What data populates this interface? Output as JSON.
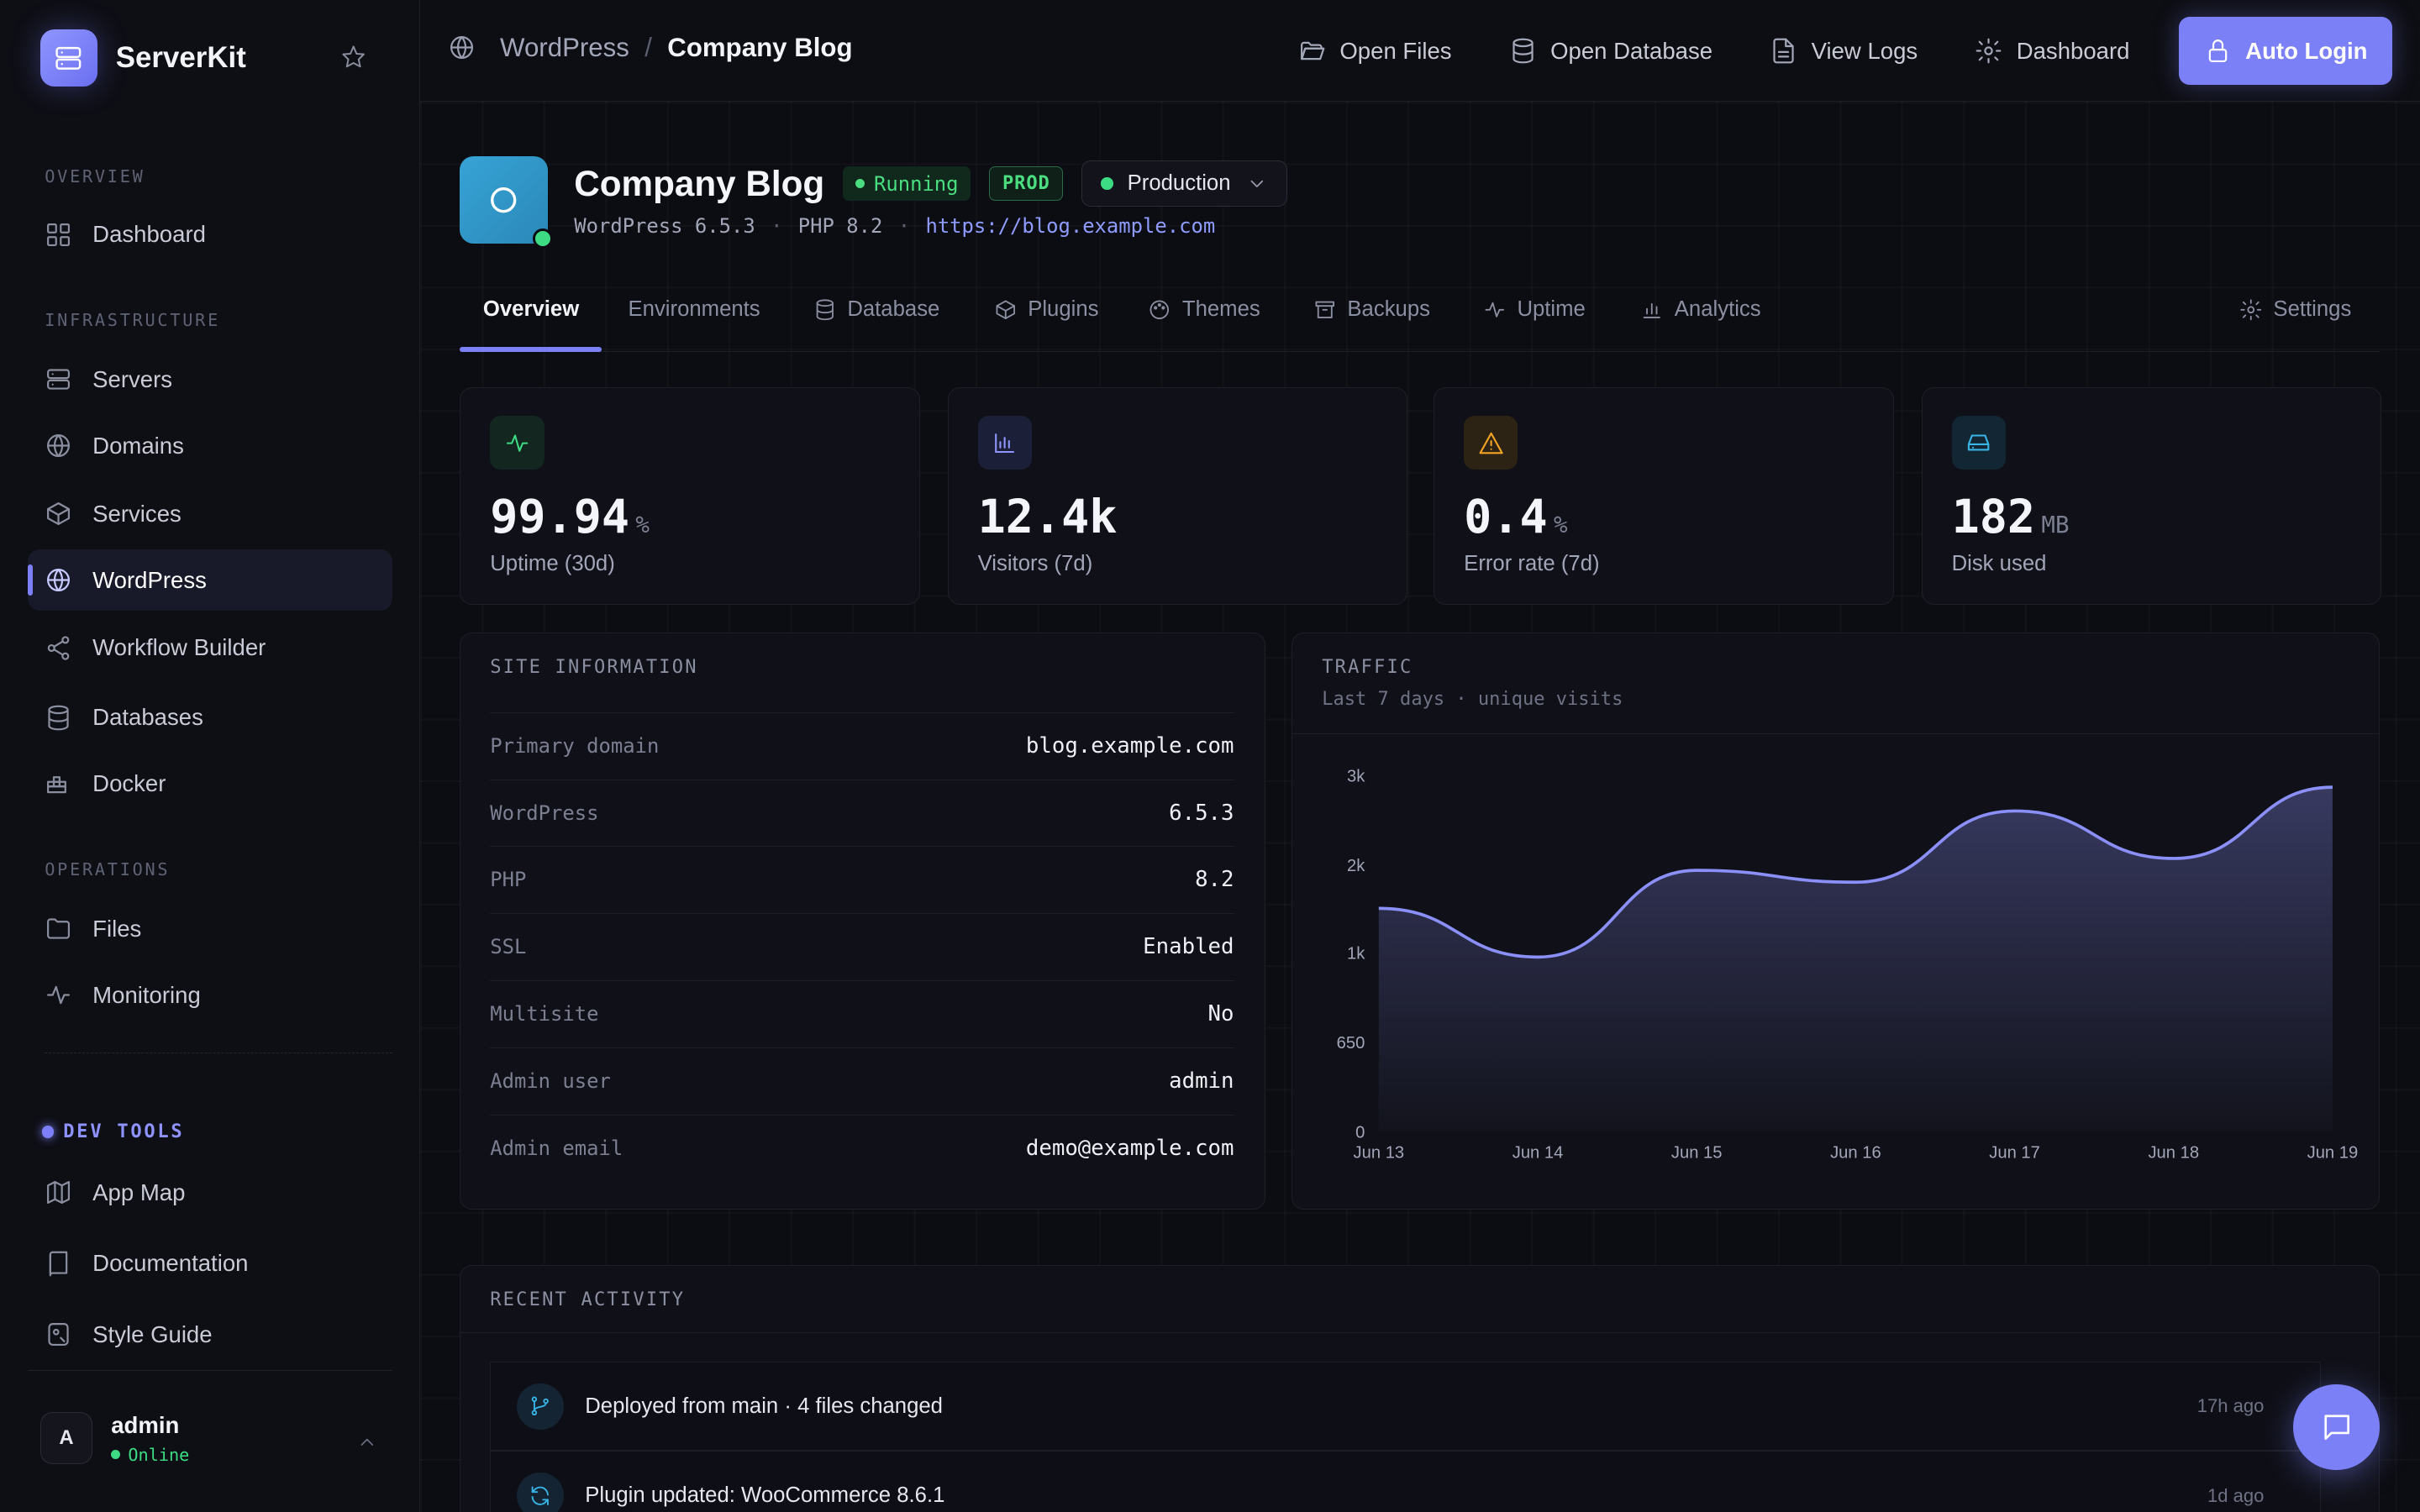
{
  "app": {
    "name": "ServerKit"
  },
  "sidebar": {
    "sections": {
      "overview": "OVERVIEW",
      "infrastructure": "INFRASTRUCTURE",
      "operations": "OPERATIONS",
      "devtools": "DEV TOOLS"
    },
    "items": {
      "dashboard": "Dashboard",
      "servers": "Servers",
      "domains": "Domains",
      "services": "Services",
      "wordpress": "WordPress",
      "workflow": "Workflow Builder",
      "databases": "Databases",
      "docker": "Docker",
      "files": "Files",
      "monitoring": "Monitoring",
      "appmap": "App Map",
      "documentation": "Documentation",
      "styleguide": "Style Guide"
    },
    "active": "wordpress",
    "user": {
      "initial": "A",
      "name": "admin",
      "status": "Online"
    }
  },
  "topbar": {
    "breadcrumb": {
      "parent": "WordPress",
      "separator": "/",
      "current": "Company Blog"
    },
    "actions": {
      "open_files": "Open Files",
      "open_database": "Open Database",
      "view_logs": "View Logs",
      "dashboard": "Dashboard",
      "auto_login": "Auto Login"
    }
  },
  "site": {
    "title": "Company Blog",
    "status": "Running",
    "badge": "PROD",
    "environment": "Production",
    "wordpress": "WordPress 6.5.3",
    "php": "PHP 8.2",
    "separator": "·",
    "url": "https://blog.example.com"
  },
  "tabs": {
    "overview": "Overview",
    "environments": "Environments",
    "database": "Database",
    "plugins": "Plugins",
    "themes": "Themes",
    "backups": "Backups",
    "uptime": "Uptime",
    "analytics": "Analytics",
    "settings": "Settings"
  },
  "stats": {
    "uptime": {
      "value": "99.94",
      "unit": "%",
      "label": "Uptime (30d)"
    },
    "visitors": {
      "value": "12.4k",
      "unit": "",
      "label": "Visitors (7d)"
    },
    "errors": {
      "value": "0.4",
      "unit": "%",
      "label": "Error rate (7d)"
    },
    "disk": {
      "value": "182",
      "unit": "MB",
      "label": "Disk used"
    }
  },
  "site_info": {
    "title": "SITE INFORMATION",
    "rows": [
      {
        "key": "Primary domain",
        "value": "blog.example.com"
      },
      {
        "key": "WordPress",
        "value": "6.5.3"
      },
      {
        "key": "PHP",
        "value": "8.2"
      },
      {
        "key": "SSL",
        "value": "Enabled"
      },
      {
        "key": "Multisite",
        "value": "No"
      },
      {
        "key": "Admin user",
        "value": "admin"
      },
      {
        "key": "Admin email",
        "value": "demo@example.com"
      }
    ]
  },
  "traffic": {
    "title": "TRAFFIC",
    "subtitle": "Last 7 days · unique visits"
  },
  "chart_data": {
    "type": "area",
    "title": "TRAFFIC",
    "subtitle": "Last 7 days · unique visits",
    "x": [
      "Jun 13",
      "Jun 14",
      "Jun 15",
      "Jun 16",
      "Jun 17",
      "Jun 18",
      "Jun 19"
    ],
    "y_ticks": [
      "0",
      "650",
      "1k",
      "2k",
      "3k"
    ],
    "values": [
      1880,
      1470,
      2200,
      2100,
      2700,
      2300,
      2900
    ],
    "ylim": [
      0,
      3000
    ],
    "grid": false,
    "legend": "none",
    "color": "#8b8ff8"
  },
  "activity": {
    "title": "RECENT ACTIVITY",
    "items": [
      {
        "text": "Deployed from main · 4 files changed",
        "time": "17h ago"
      },
      {
        "text": "Plugin updated: WooCommerce 8.6.1",
        "time": "1d ago"
      }
    ]
  },
  "colors": {
    "accent": "#7b80f7",
    "success": "#3ddc84",
    "warning": "#f5a524",
    "info": "#38b6e8"
  }
}
